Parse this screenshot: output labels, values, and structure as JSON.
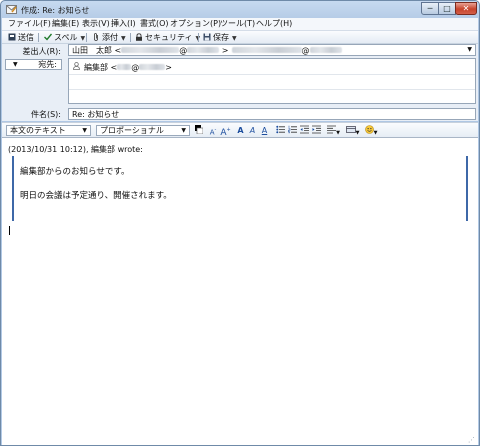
{
  "window": {
    "title": "作成: Re: お知らせ",
    "controls": {
      "minimize": "─",
      "maximize": "□",
      "close": "✕"
    }
  },
  "menu": [
    "ファイル(F)",
    "編集(E)",
    "表示(V)",
    "挿入(I)",
    "書式(O)",
    "オプション(P)",
    "ツール(T)",
    "ヘルプ(H)"
  ],
  "toolbar": {
    "send": "送信",
    "spell": "スペル",
    "attach": "添付",
    "security": "セキュリティ",
    "save": "保存"
  },
  "header": {
    "from_label": "差出人(R):",
    "from_name": "山田　太郎 <",
    "from_at": "@",
    "from_mid": " >",
    "to_type": "宛先:",
    "to_value_prefix": "編集部 <",
    "to_value_at": "@",
    "to_value_suffix": ">",
    "subject_label": "件名(S):",
    "subject_value": "Re: お知らせ"
  },
  "format": {
    "paragraph": "本文のテキスト",
    "font": "プロポーショナル"
  },
  "message": {
    "attribution": "(2013/10/31 10:12), 編集部 wrote:",
    "quoted_line1": "編集部からのお知らせです。",
    "quoted_line2": "明日の会議は予定通り、開催されます。"
  }
}
